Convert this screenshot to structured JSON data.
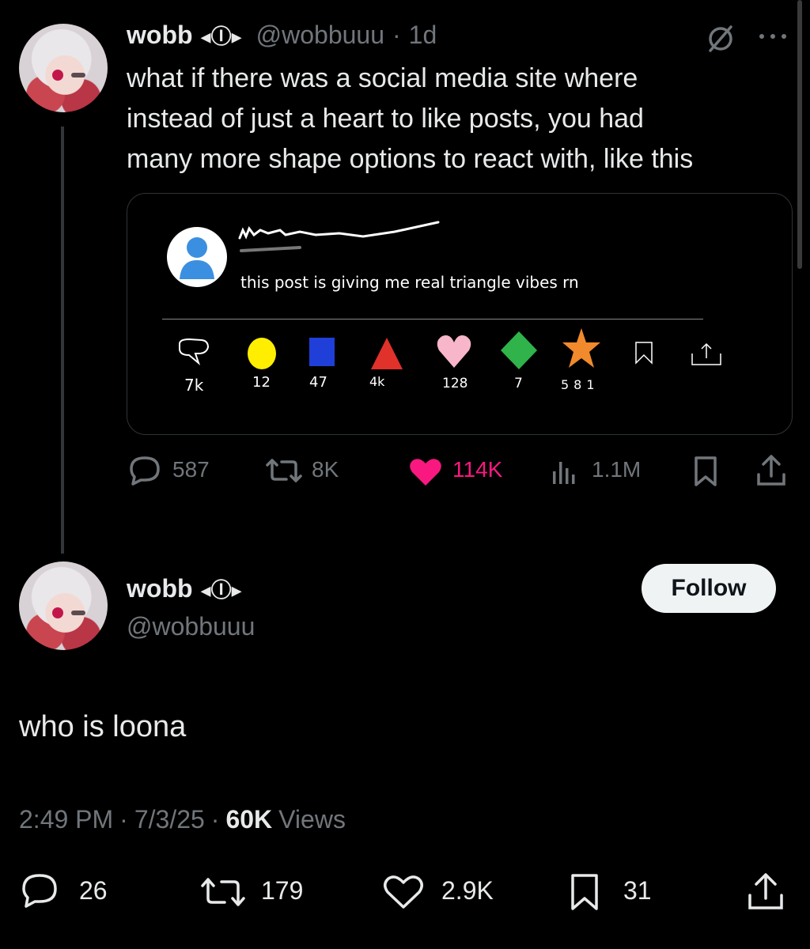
{
  "original_tweet": {
    "author_name": "wobb",
    "author_badge": "◂Ⓘ▸",
    "handle": "@wobbuuu",
    "time": "1d",
    "separator": "·",
    "text_lines": [
      "what if there was a social media site where",
      "instead of just a heart to like posts, you had",
      "many more shape options to react with, like this"
    ],
    "quote": {
      "scribble_name": "",
      "body": "this post is giving me real triangle vibes rn",
      "reactions": [
        {
          "icon": "comment-bubble-icon",
          "count": "7k",
          "color": "#ffffff"
        },
        {
          "icon": "yellow-circle-icon",
          "count": "12",
          "color": "#ffee00"
        },
        {
          "icon": "blue-square-icon",
          "count": "47",
          "color": "#1f3fd8"
        },
        {
          "icon": "red-triangle-icon",
          "count": "4k",
          "color": "#e0312b"
        },
        {
          "icon": "pink-heart-icon",
          "count": "128",
          "color": "#f7b6c9"
        },
        {
          "icon": "green-diamond-icon",
          "count": "7",
          "color": "#2fb34a"
        },
        {
          "icon": "orange-star-icon",
          "count": "581",
          "color": "#f08a2c"
        },
        {
          "icon": "bookmark-icon",
          "count": "",
          "color": "#ffffff"
        },
        {
          "icon": "share-icon",
          "count": "",
          "color": "#ffffff"
        }
      ]
    },
    "stats": {
      "replies": "587",
      "reposts": "8K",
      "likes": "114K",
      "views": "1.1M"
    },
    "like_color": "#f91880"
  },
  "reply_tweet": {
    "author_name": "wobb",
    "author_badge": "◂Ⓘ▸",
    "handle": "@wobbuuu",
    "follow_label": "Follow",
    "text": "who is loona",
    "meta": {
      "time": "2:49 PM",
      "date": "7/3/25",
      "views_count": "60K",
      "views_label": "Views",
      "separator": "·"
    },
    "stats": {
      "replies": "26",
      "reposts": "179",
      "likes": "2.9K",
      "bookmarks": "31"
    }
  }
}
